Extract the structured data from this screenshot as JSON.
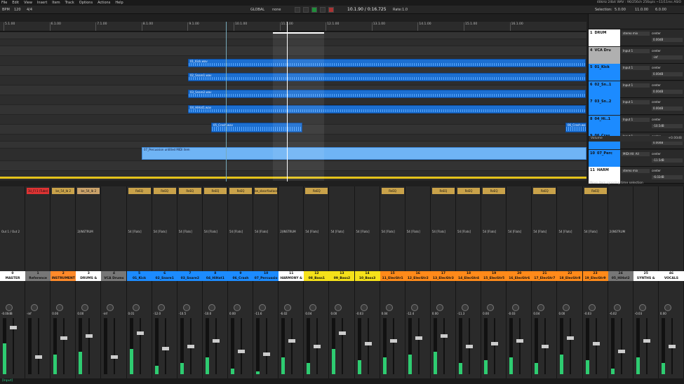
{
  "menu": [
    "File",
    "Edit",
    "View",
    "Insert",
    "Item",
    "Track",
    "Options",
    "Actions",
    "Help"
  ],
  "sysinfo": "48kHz 24bit WAV : 96/256ch 256spls ~11/11ms ASIO",
  "toolbar": {
    "bpm": "BPM",
    "bpm_value": "120",
    "sig": "4/4",
    "mode": "GLOBAL",
    "pattern": "none",
    "time": "10.1.90 / 0:16.725",
    "rate": "Rate:1.0",
    "selection_label": "Selection:",
    "sel_start": "5.0.00",
    "sel_end": "11.0.00",
    "sel_len": "6.0.00"
  },
  "ruler": [
    "5.1.00",
    "6.1.00",
    "7.1.00",
    "8.1.00",
    "9.1.00",
    "10.1.00",
    "11.1.00",
    "12.1.00",
    "13.1.00",
    "14.1.00",
    "15.1.00",
    "16.1.00"
  ],
  "ruler_times": [
    "0:08.000",
    "0:10.000",
    "0:12.000",
    "0:14.000",
    "0:16.000",
    "0:18.000",
    "0:20.000",
    "0:22.000",
    "0:24.000",
    "0:26.000",
    "0:28.000",
    "0:30.000"
  ],
  "clips": [
    {
      "name": "01_Kick.wav",
      "type": "audio"
    },
    {
      "name": "02_Snare1.wav",
      "type": "audio"
    },
    {
      "name": "03_Snare2.wav",
      "type": "audio"
    },
    {
      "name": "04_HiHat1.wav",
      "type": "audio"
    },
    {
      "name": "05_Crash.wav",
      "type": "audio"
    },
    {
      "name": "06_Crash.wav",
      "type": "audio"
    },
    {
      "name": "07_Percussion untitled MIDI item",
      "type": "midi"
    }
  ],
  "tracks": [
    {
      "num": "1",
      "name": "DRUM",
      "color": "#ffffff",
      "input": "stereo mix",
      "vol": "0.00dB",
      "pan": "center"
    },
    {
      "num": "4",
      "name": "VCA Dru",
      "color": "#b0b0b0",
      "input": "Input 1",
      "vol": "-inf",
      "pan": "center"
    },
    {
      "num": "5",
      "name": "01_Kick",
      "color": "#1c8bff",
      "input": "Input 1",
      "vol": "0.00dB",
      "pan": "center"
    },
    {
      "num": "6",
      "name": "02_Sn..1",
      "color": "#1c8bff",
      "input": "Input 1",
      "vol": "0.00dB",
      "pan": "center"
    },
    {
      "num": "7",
      "name": "03_Sn..2",
      "color": "#1c8bff",
      "input": "Input 1",
      "vol": "0.00dB",
      "pan": "center"
    },
    {
      "num": "8",
      "name": "04_Hi..1",
      "color": "#1c8bff",
      "input": "Input 1",
      "vol": "-10.5dB",
      "pan": "center"
    },
    {
      "num": "9",
      "name": "06_Cras",
      "color": "#1c8bff",
      "input": "Input 1",
      "vol": "0.00dB",
      "pan": "center"
    },
    {
      "num": "10",
      "name": "07_Perc",
      "color": "#1c8bff",
      "input": "MIDI All: All",
      "vol": "-11.5dB",
      "pan": "center"
    },
    {
      "num": "11",
      "name": "HARM",
      "color": "#ffffff",
      "input": "stereo mix",
      "vol": "-6.02dB",
      "pan": "center"
    }
  ],
  "volume_label": "Volume",
  "volume_value": "+0.00dB",
  "hint": "Move item ignoring time selection",
  "mixer": [
    {
      "num": "0",
      "name": "MASTER",
      "color": "#ffffff",
      "db": "-0.00dB",
      "fx": "",
      "io": "Out 1 / Out 2",
      "level": 0.55
    },
    {
      "num": "1",
      "name": "Reference",
      "color": "#777777",
      "db": "-inf",
      "fx": "1U_FI 1 (Tube)",
      "io": "",
      "level": 0
    },
    {
      "num": "2",
      "name": "INSTRUMENT",
      "color": "#ff8a2a",
      "db": "0.00",
      "fx": "be_54_Ib 2",
      "io": "",
      "level": 0.35
    },
    {
      "num": "3",
      "name": "DRUMS &",
      "color": "#ffffff",
      "db": "0.00",
      "fx": "be_54_Ib 2",
      "io": "2(INSTRUM",
      "level": 0.4
    },
    {
      "num": "4",
      "name": "VCA Drums",
      "color": "#777777",
      "db": "-inf",
      "fx": "",
      "io": "",
      "level": 0
    },
    {
      "num": "5",
      "name": "01_Kick",
      "color": "#1c8bff",
      "db": "0.01",
      "fx": "ReEQ",
      "io": "54 [Flats]",
      "level": 0.45
    },
    {
      "num": "6",
      "name": "02_Snare1",
      "color": "#1c8bff",
      "db": "-12.0",
      "fx": "ReEQ",
      "io": "54 [Flats]",
      "level": 0.15
    },
    {
      "num": "7",
      "name": "03_Snare2",
      "color": "#1c8bff",
      "db": "-10.5",
      "fx": "ReEQ",
      "io": "54 [Flats]",
      "level": 0.2
    },
    {
      "num": "8",
      "name": "04_HiHat1",
      "color": "#1c8bff",
      "db": "-10.0",
      "fx": "ReEQ",
      "io": "54 [Flats]",
      "level": 0.3
    },
    {
      "num": "9",
      "name": "06_Crash",
      "color": "#1c8bff",
      "db": "0.00",
      "fx": "ReEQ",
      "io": "54 [Flats]",
      "level": 0.1
    },
    {
      "num": "10",
      "name": "07_Percussio",
      "color": "#1c8bff",
      "db": "-11.6",
      "fx": "be_sbsvrfautaom",
      "io": "54 [Flats]",
      "level": 0.05
    },
    {
      "num": "11",
      "name": "HARMONY &",
      "color": "#ffffff",
      "db": "-6.02",
      "fx": "",
      "io": "2(INSTRUM",
      "level": 0.3
    },
    {
      "num": "12",
      "name": "08_Bass1",
      "color": "#f5e11a",
      "db": "0.04",
      "fx": "ReEQ",
      "io": "54 [Flats]",
      "level": 0.2
    },
    {
      "num": "13",
      "name": "09_Bass2",
      "color": "#f5e11a",
      "db": "0.00",
      "fx": "",
      "io": "54 [Flats]",
      "level": 0.45
    },
    {
      "num": "14",
      "name": "10_Bass3",
      "color": "#f5e11a",
      "db": "-0.03",
      "fx": "",
      "io": "54 [Flats]",
      "level": 0.25
    },
    {
      "num": "15",
      "name": "11_ElecGtr1",
      "color": "#ff8a1a",
      "db": "0.04",
      "fx": "ReEQ",
      "io": "54 [Flats]",
      "level": 0.3
    },
    {
      "num": "16",
      "name": "12_ElecGtr2",
      "color": "#ff8a1a",
      "db": "-12.4",
      "fx": "",
      "io": "54 [Flats]",
      "level": 0.35
    },
    {
      "num": "17",
      "name": "13_ElecGtr3",
      "color": "#ff8a1a",
      "db": "0.00",
      "fx": "ReEQ",
      "io": "54 [Flats]",
      "level": 0.4
    },
    {
      "num": "18",
      "name": "14_ElecGtr4",
      "color": "#ff8a1a",
      "db": "-11.3",
      "fx": "ReEQ",
      "io": "54 [Flats]",
      "level": 0.2
    },
    {
      "num": "19",
      "name": "15_ElecGtr5",
      "color": "#ff8a1a",
      "db": "0.00",
      "fx": "ReEQ",
      "io": "54 [Flats]",
      "level": 0.25
    },
    {
      "num": "20",
      "name": "16_ElecGtr6",
      "color": "#ff8a1a",
      "db": "-0.03",
      "fx": "",
      "io": "54 [Flats]",
      "level": 0.3
    },
    {
      "num": "21",
      "name": "17_ElecGtr7",
      "color": "#ff8a1a",
      "db": "0.04",
      "fx": "ReEQ",
      "io": "54 [Flats]",
      "level": 0.2
    },
    {
      "num": "22",
      "name": "18_ElecGtr8",
      "color": "#ff8a1a",
      "db": "0.00",
      "fx": "",
      "io": "54 [Flats]",
      "level": 0.35
    },
    {
      "num": "23",
      "name": "19_ElecGtr9",
      "color": "#ff8a1a",
      "db": "-0.03",
      "fx": "ReEQ",
      "io": "54 [Flats]",
      "level": 0.25
    },
    {
      "num": "24",
      "name": "05_HiHat2",
      "color": "#777777",
      "db": "-6.02",
      "fx": "",
      "io": "2(INSTRUM",
      "level": 0.1
    },
    {
      "num": "25",
      "name": "SYNTHS &",
      "color": "#ffffff",
      "db": "-0.03",
      "fx": "",
      "io": "",
      "level": 0.3
    },
    {
      "num": "46",
      "name": "VOCALS",
      "color": "#ffffff",
      "db": "0.00",
      "fx": "",
      "io": "",
      "level": 0.2
    }
  ],
  "status": "[Input]"
}
